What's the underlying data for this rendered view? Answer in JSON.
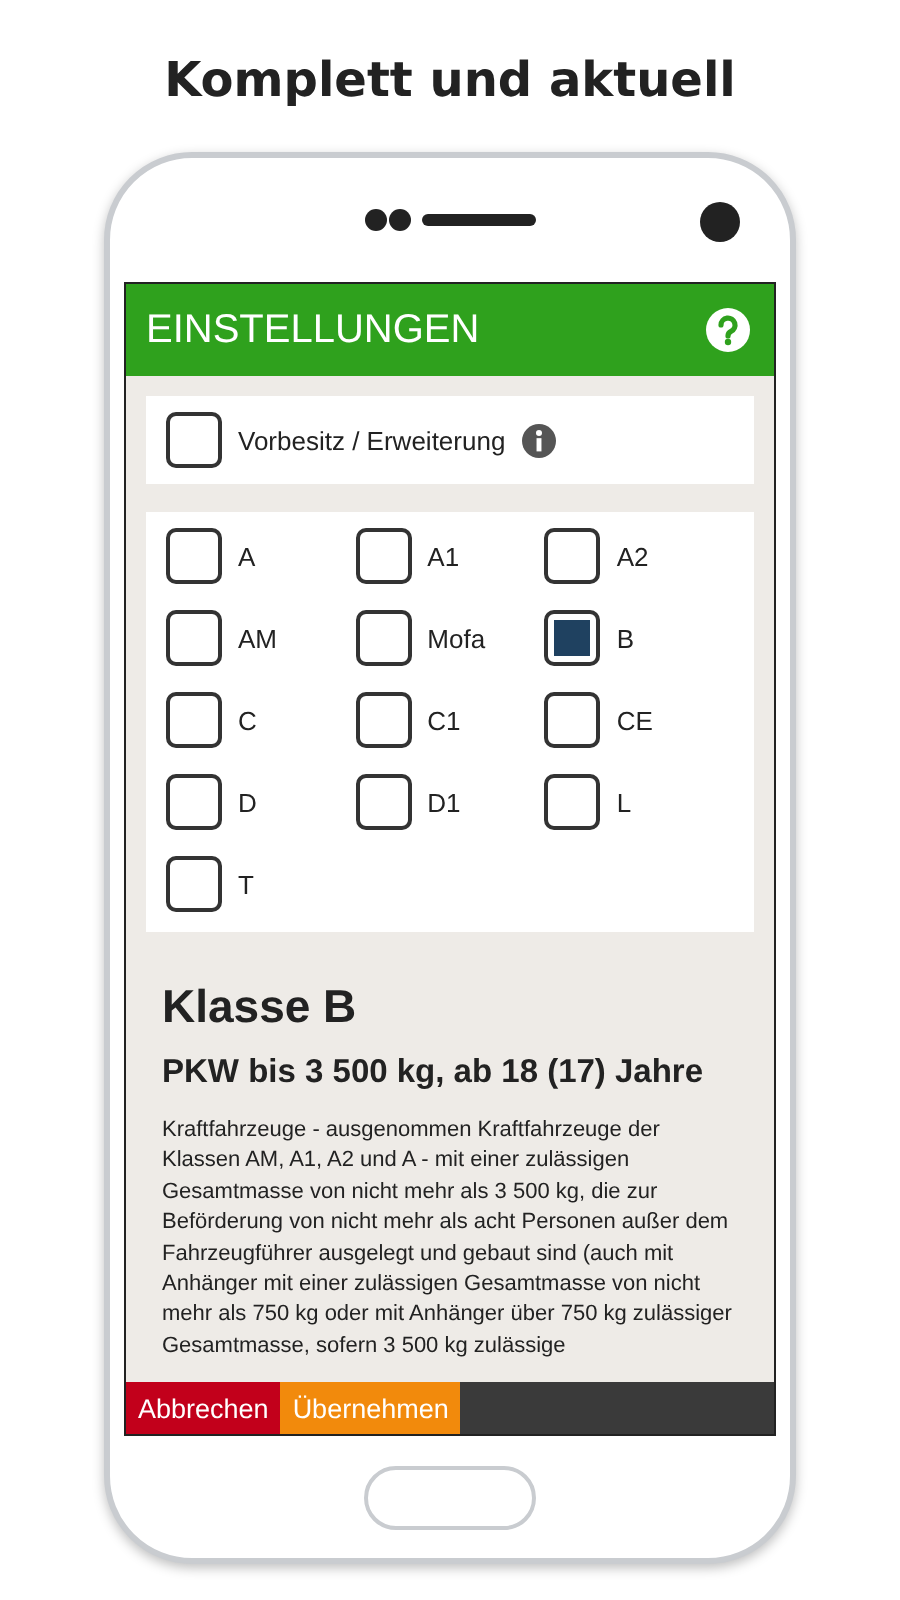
{
  "headline": "Komplett und aktuell",
  "header": {
    "title": "EINSTELLUNGEN"
  },
  "prior_option": {
    "label": "Vorbesitz / Erweiterung",
    "checked": false
  },
  "classes": [
    {
      "label": "A",
      "checked": false
    },
    {
      "label": "A1",
      "checked": false
    },
    {
      "label": "A2",
      "checked": false
    },
    {
      "label": "AM",
      "checked": false
    },
    {
      "label": "Mofa",
      "checked": false
    },
    {
      "label": "B",
      "checked": true
    },
    {
      "label": "C",
      "checked": false
    },
    {
      "label": "C1",
      "checked": false
    },
    {
      "label": "CE",
      "checked": false
    },
    {
      "label": "D",
      "checked": false
    },
    {
      "label": "D1",
      "checked": false
    },
    {
      "label": "L",
      "checked": false
    },
    {
      "label": "T",
      "checked": false
    }
  ],
  "detail": {
    "title": "Klasse B",
    "subtitle": "PKW bis 3 500 kg, ab 18 (17) Jahre",
    "text": "Kraftfahrzeuge - ausgenommen Kraftfahrzeuge der Klassen AM, A1, A2 und A - mit einer zulässigen Gesamtmasse von nicht mehr als 3 500 kg, die zur Beförderung von nicht mehr als acht Personen außer dem Fahrzeugführer ausgelegt und gebaut sind (auch mit Anhänger mit einer zulässigen Gesamtmasse von nicht mehr als 750 kg oder mit Anhänger über 750 kg zulässiger Gesamtmasse, sofern 3 500 kg zulässige"
  },
  "buttons": [
    {
      "label": "Abbrechen",
      "kind": "cancel"
    },
    {
      "label": "Übernehmen",
      "kind": "confirm"
    }
  ]
}
